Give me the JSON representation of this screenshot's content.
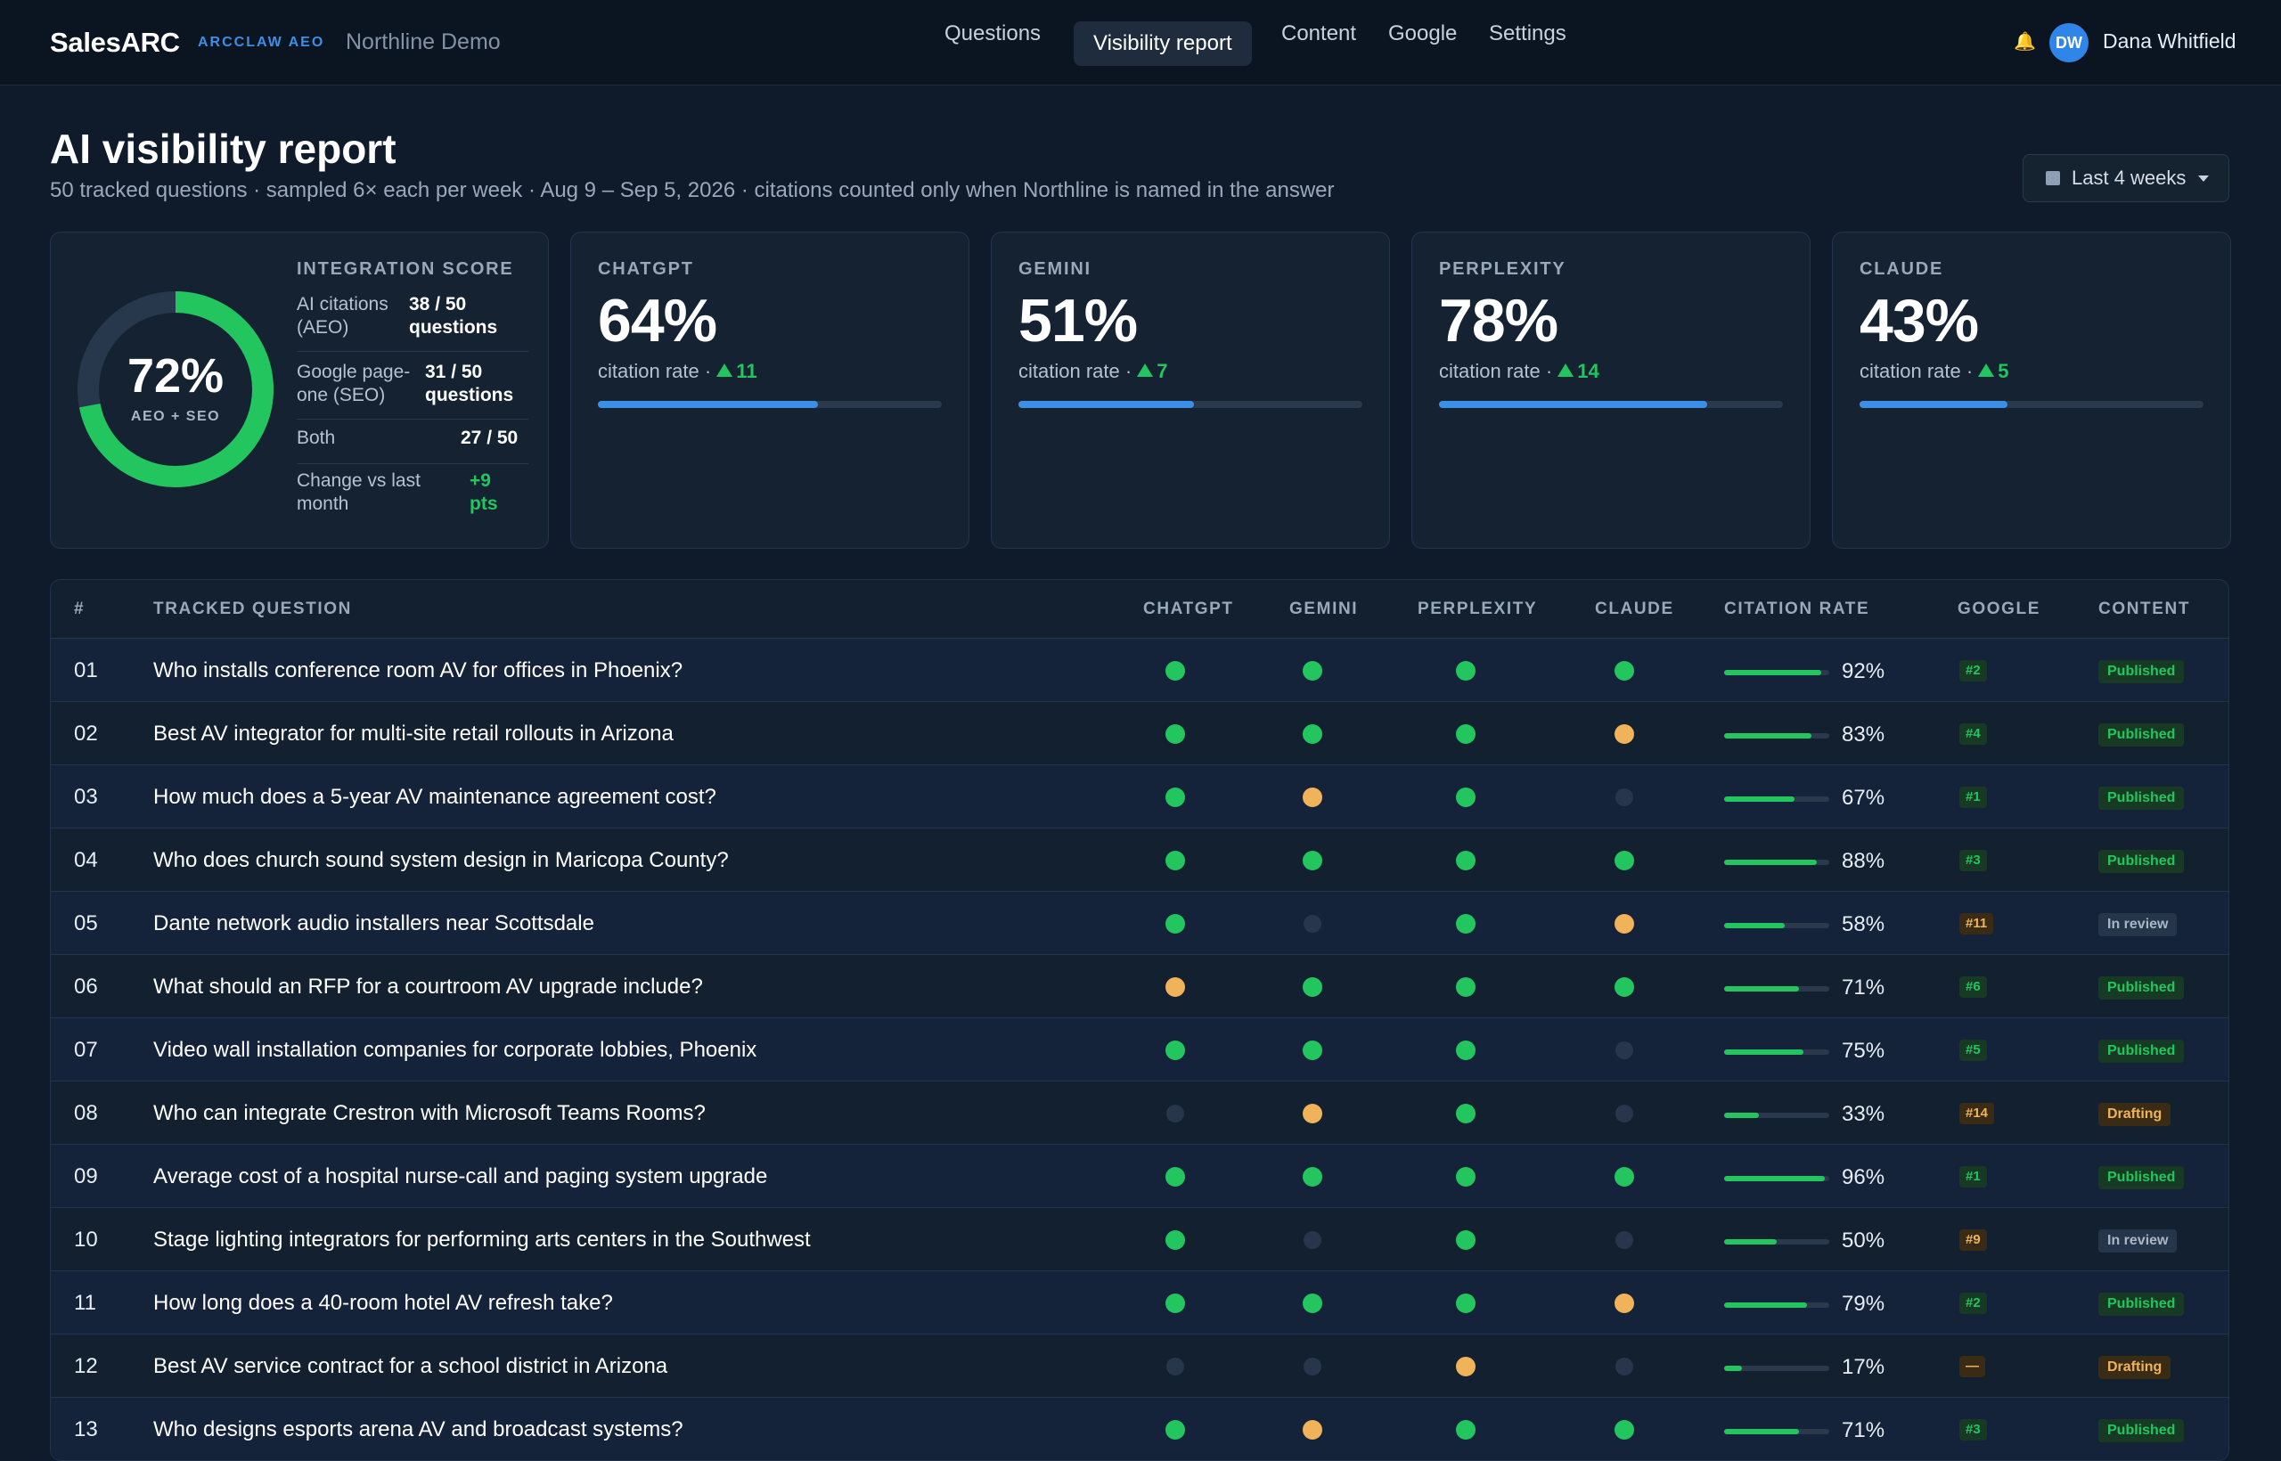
{
  "header": {
    "brand": "SalesARC",
    "tag": "ARCCLAW AEO",
    "client": "Northline Demo",
    "nav": [
      "Questions",
      "Visibility report",
      "Content",
      "Google",
      "Settings"
    ],
    "active_nav": "Visibility report",
    "user_initials": "DW",
    "user_name": "Dana Whitfield",
    "bell_icon": "bell-icon"
  },
  "page": {
    "title": "AI visibility report",
    "subtitle": "50 tracked questions · sampled 6× each per week · Aug 9 – Sep 5, 2026 · citations counted only when Northline is named in the answer",
    "range_label": "Last 4 weeks"
  },
  "score_card": {
    "title": "INTEGRATION SCORE",
    "value": "72%",
    "value_fraction": 0.72,
    "label": "AEO + SEO",
    "rows": [
      {
        "k": "AI citations (AEO)",
        "v": "38 / 50 questions"
      },
      {
        "k": "Google page-one (SEO)",
        "v": "31 / 50 questions"
      },
      {
        "k": "Both",
        "v": "27 / 50"
      },
      {
        "k": "Change vs last month",
        "v": "+9 pts"
      }
    ]
  },
  "llm_cards": [
    {
      "name": "CHATGPT",
      "pct": "64%",
      "sub": "citation rate ·",
      "delta": "11",
      "fraction": 0.64
    },
    {
      "name": "GEMINI",
      "pct": "51%",
      "sub": "citation rate ·",
      "delta": "7",
      "fraction": 0.51
    },
    {
      "name": "PERPLEXITY",
      "pct": "78%",
      "sub": "citation rate ·",
      "delta": "14",
      "fraction": 0.78
    },
    {
      "name": "CLAUDE",
      "pct": "43%",
      "sub": "citation rate ·",
      "delta": "5",
      "fraction": 0.43
    }
  ],
  "table": {
    "headers": [
      "#",
      "TRACKED QUESTION",
      "CHATGPT",
      "GEMINI",
      "PERPLEXITY",
      "CLAUDE",
      "CITATION RATE",
      "GOOGLE",
      "CONTENT"
    ],
    "rows": [
      {
        "num": "01",
        "q": "Who installs conference room AV for offices in Phoenix?",
        "cg": "green",
        "gm": "green",
        "px": "green",
        "cl": "green",
        "rate": "92%",
        "rate_fraction": 0.92,
        "google": "#2",
        "google_tone": "good",
        "content": "Published",
        "content_tone": "published"
      },
      {
        "num": "02",
        "q": "Best AV integrator for multi-site retail rollouts in Arizona",
        "cg": "green",
        "gm": "green",
        "px": "green",
        "cl": "amber",
        "rate": "83%",
        "rate_fraction": 0.83,
        "google": "#4",
        "google_tone": "good",
        "content": "Published",
        "content_tone": "published"
      },
      {
        "num": "03",
        "q": "How much does a 5-year AV maintenance agreement cost?",
        "cg": "green",
        "gm": "amber",
        "px": "green",
        "cl": "none",
        "rate": "67%",
        "rate_fraction": 0.67,
        "google": "#1",
        "google_tone": "good",
        "content": "Published",
        "content_tone": "published"
      },
      {
        "num": "04",
        "q": "Who does church sound system design in Maricopa County?",
        "cg": "green",
        "gm": "green",
        "px": "green",
        "cl": "green",
        "rate": "88%",
        "rate_fraction": 0.88,
        "google": "#3",
        "google_tone": "good",
        "content": "Published",
        "content_tone": "published"
      },
      {
        "num": "05",
        "q": "Dante network audio installers near Scottsdale",
        "cg": "green",
        "gm": "none",
        "px": "green",
        "cl": "amber",
        "rate": "58%",
        "rate_fraction": 0.58,
        "google": "#11",
        "google_tone": "mid",
        "content": "In review",
        "content_tone": "review"
      },
      {
        "num": "06",
        "q": "What should an RFP for a courtroom AV upgrade include?",
        "cg": "amber",
        "gm": "green",
        "px": "green",
        "cl": "green",
        "rate": "71%",
        "rate_fraction": 0.71,
        "google": "#6",
        "google_tone": "good",
        "content": "Published",
        "content_tone": "published"
      },
      {
        "num": "07",
        "q": "Video wall installation companies for corporate lobbies, Phoenix",
        "cg": "green",
        "gm": "green",
        "px": "green",
        "cl": "none",
        "rate": "75%",
        "rate_fraction": 0.75,
        "google": "#5",
        "google_tone": "good",
        "content": "Published",
        "content_tone": "published"
      },
      {
        "num": "08",
        "q": "Who can integrate Crestron with Microsoft Teams Rooms?",
        "cg": "none",
        "gm": "amber",
        "px": "green",
        "cl": "none",
        "rate": "33%",
        "rate_fraction": 0.33,
        "google": "#14",
        "google_tone": "mid",
        "content": "Drafting",
        "content_tone": "drafting"
      },
      {
        "num": "09",
        "q": "Average cost of a hospital nurse-call and paging system upgrade",
        "cg": "green",
        "gm": "green",
        "px": "green",
        "cl": "green",
        "rate": "96%",
        "rate_fraction": 0.96,
        "google": "#1",
        "google_tone": "good",
        "content": "Published",
        "content_tone": "published"
      },
      {
        "num": "10",
        "q": "Stage lighting integrators for performing arts centers in the Southwest",
        "cg": "green",
        "gm": "none",
        "px": "green",
        "cl": "none",
        "rate": "50%",
        "rate_fraction": 0.5,
        "google": "#9",
        "google_tone": "mid",
        "content": "In review",
        "content_tone": "review"
      },
      {
        "num": "11",
        "q": "How long does a 40-room hotel AV refresh take?",
        "cg": "green",
        "gm": "green",
        "px": "green",
        "cl": "amber",
        "rate": "79%",
        "rate_fraction": 0.79,
        "google": "#2",
        "google_tone": "good",
        "content": "Published",
        "content_tone": "published"
      },
      {
        "num": "12",
        "q": "Best AV service contract for a school district in Arizona",
        "cg": "none",
        "gm": "none",
        "px": "amber",
        "cl": "none",
        "rate": "17%",
        "rate_fraction": 0.17,
        "google": "—",
        "google_tone": "mid",
        "content": "Drafting",
        "content_tone": "drafting"
      },
      {
        "num": "13",
        "q": "Who designs esports arena AV and broadcast systems?",
        "cg": "green",
        "gm": "amber",
        "px": "green",
        "cl": "green",
        "rate": "71%",
        "rate_fraction": 0.71,
        "google": "#3",
        "google_tone": "good",
        "content": "Published",
        "content_tone": "published"
      }
    ]
  },
  "colors": {
    "accent": "#3b8fe6",
    "good": "#22c55e",
    "warn": "#f0b35a",
    "bg": "#0f1b2b"
  }
}
